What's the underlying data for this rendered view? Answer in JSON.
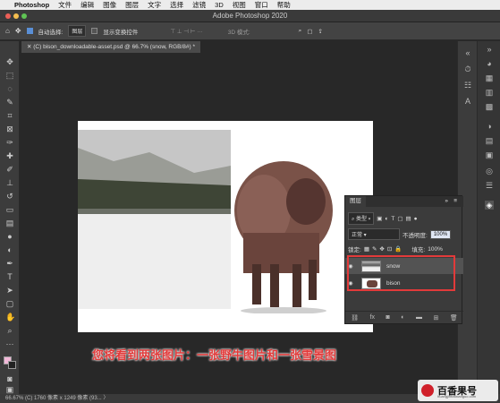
{
  "menubar": {
    "apple": "",
    "items": [
      "Photoshop",
      "文件",
      "编辑",
      "图像",
      "图层",
      "文字",
      "选择",
      "滤镜",
      "3D",
      "视图",
      "窗口",
      "帮助"
    ]
  },
  "window": {
    "title": "Adobe Photoshop 2020"
  },
  "options_bar": {
    "auto_select_label": "自动选择:",
    "auto_select_value": "图层",
    "show_transform_label": "显示变换控件",
    "mode_3d_label": "3D 模式:"
  },
  "document_tab": {
    "label": "(C) bison_downloadable-asset.psd @ 66.7% (snow, RGB/8#) *"
  },
  "layers_panel": {
    "tab_label": "图层",
    "filter_label": "类型",
    "blend_mode": "正常",
    "opacity_label": "不透明度:",
    "opacity_value": "100%",
    "lock_label": "锁定:",
    "fill_label": "填充:",
    "fill_value": "100%",
    "layers": [
      {
        "name": "snow",
        "selected": true
      },
      {
        "name": "bison",
        "selected": false
      }
    ]
  },
  "caption": "您将看到两张图片：一张野牛图片和一张雪景图",
  "status_bar": {
    "text": "66.67%    (C) 1760 像素 x 1249 像素 (93...  〉"
  },
  "watermark": {
    "title": "百香果号",
    "url": "huangjinbaixianguo.com"
  },
  "colors": {
    "highlight": "#e23a3a",
    "panel_bg": "#3b3b3b",
    "canvas_bg": "#282828"
  }
}
